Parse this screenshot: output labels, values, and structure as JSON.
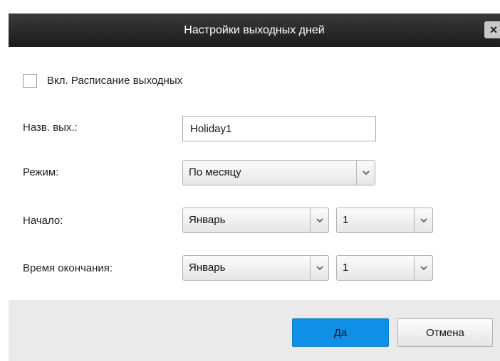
{
  "dialog": {
    "title": "Настройки выходных дней",
    "close_label": "×"
  },
  "enable": {
    "label": "Вкл. Расписание выходных",
    "checked": false
  },
  "fields": {
    "name_label": "Назв. вых.:",
    "name_value": "Holiday1",
    "mode_label": "Режим:",
    "mode_value": "По месяцу",
    "start_label": "Начало:",
    "start_month": "Январь",
    "start_day": "1",
    "end_label": "Время окончания:",
    "end_month": "Январь",
    "end_day": "1"
  },
  "buttons": {
    "ok_label": "Да",
    "cancel_label": "Отмена"
  },
  "colors": {
    "primary_button": "#0f8fe6",
    "titlebar": "#2a2a2a"
  }
}
